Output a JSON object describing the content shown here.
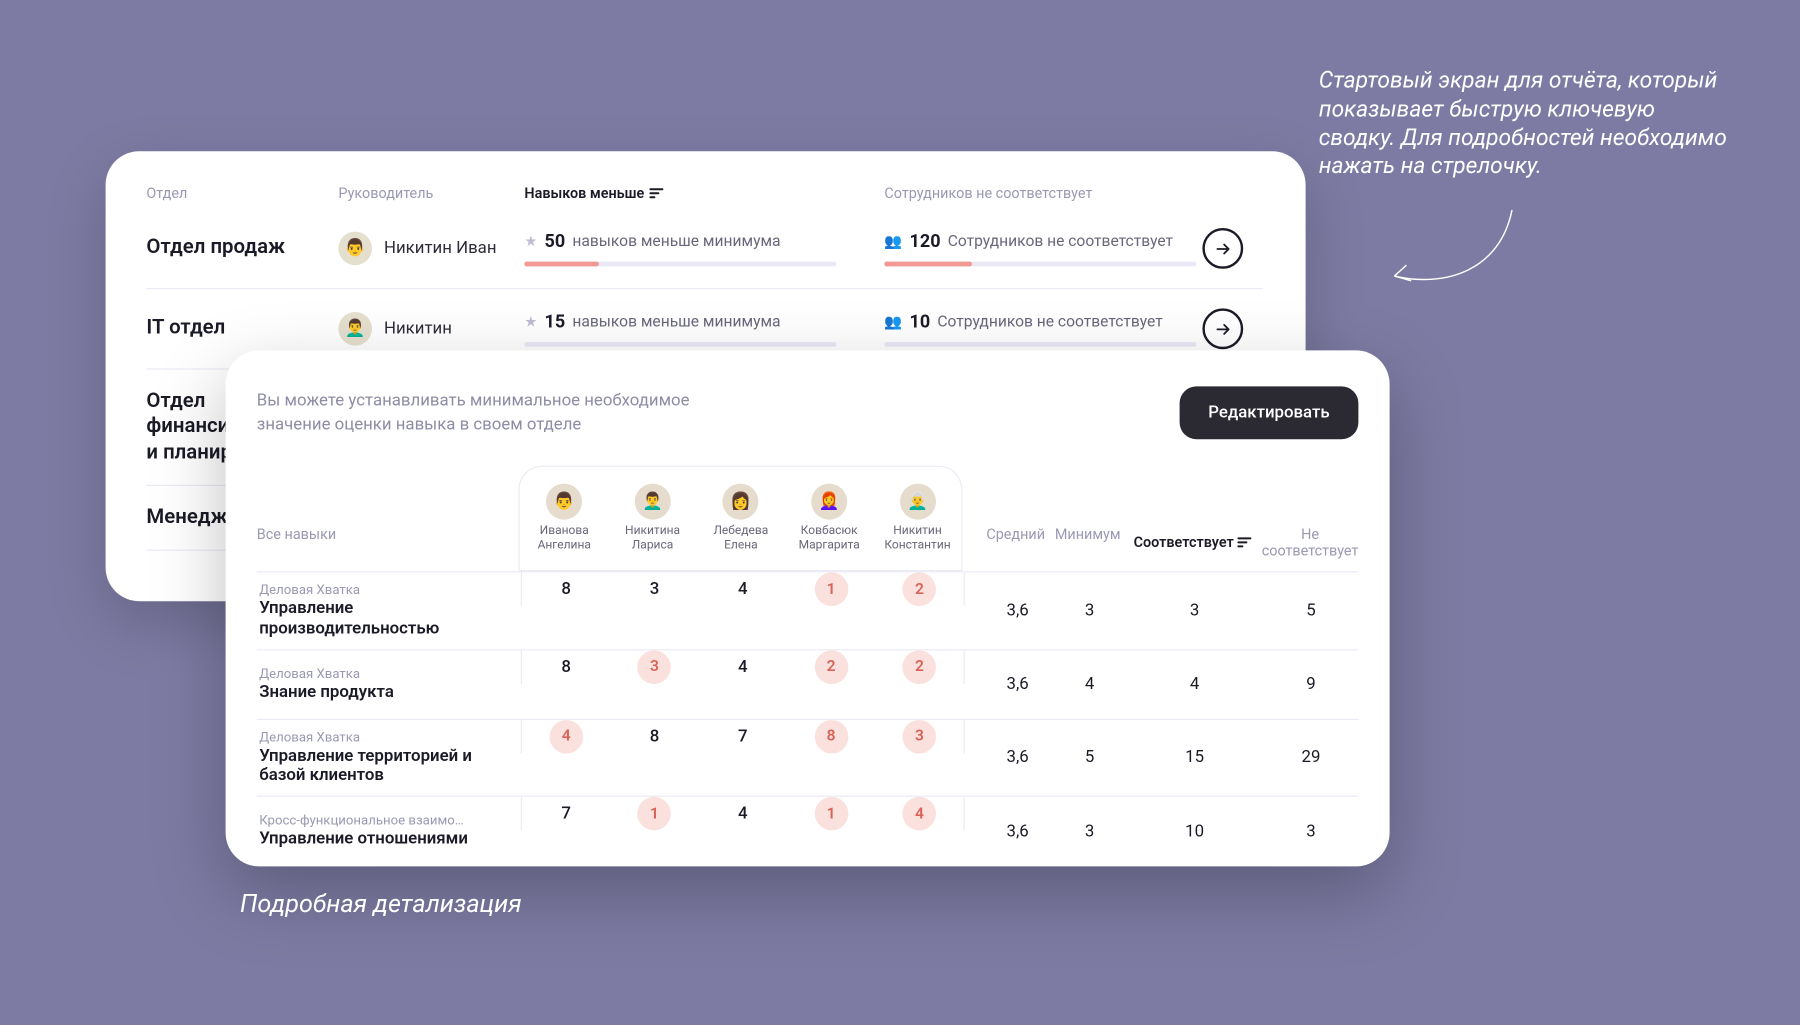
{
  "annotations": {
    "top": "Стартовый экран для отчёта, который показывает быструю ключевую сводку. Для подробностей необходимо нажать на стрелочку.",
    "bottom": "Подробная детализация"
  },
  "back": {
    "headers": {
      "dept": "Отдел",
      "manager": "Руководитель",
      "skills": "Навыков меньше",
      "employees": "Сотрудников не соответствует"
    },
    "rows": [
      {
        "dept": "Отдел продаж",
        "manager": "Никитин Иван",
        "skills_n": "50",
        "skills_txt": "навыков меньше минимума",
        "skills_pct": 24,
        "emp_n": "120",
        "emp_txt": "Сотрудников не соответствует",
        "emp_pct": 28
      },
      {
        "dept": "IT отдел",
        "manager": "Никитин",
        "skills_n": "15",
        "skills_txt": "навыков меньше минимума",
        "skills_pct": 0,
        "emp_n": "10",
        "emp_txt": "Сотрудников не соответствует",
        "emp_pct": 0
      },
      {
        "dept": "Отдел\nфинансир\nи планиро",
        "manager": "",
        "skills_n": "",
        "skills_txt": "",
        "skills_pct": 0,
        "emp_n": "",
        "emp_txt": "",
        "emp_pct": 0
      },
      {
        "dept": "Менеджм",
        "manager": "",
        "skills_n": "",
        "skills_txt": "",
        "skills_pct": 0,
        "emp_n": "",
        "emp_txt": "",
        "emp_pct": 0
      }
    ]
  },
  "front": {
    "intro": "Вы можете устанавливать минимальное необходимое значение оценки навыка в своем отделе",
    "edit": "Редактировать",
    "skill_header": "Все навыки",
    "agg_headers": {
      "avg": "Средний",
      "min": "Минимум",
      "match": "Соответствует",
      "nomatch": "Не соответствует"
    },
    "people": [
      {
        "first": "Иванова",
        "last": "Ангелина"
      },
      {
        "first": "Никитина",
        "last": "Лариса"
      },
      {
        "first": "Лебедева",
        "last": "Елена"
      },
      {
        "first": "Ковбасюк",
        "last": "Маргарита"
      },
      {
        "first": "Никитин",
        "last": "Константин"
      }
    ],
    "rows": [
      {
        "cat": "Деловая Хватка",
        "name": "Управление производительностью",
        "vals": [
          {
            "v": "8",
            "bad": false
          },
          {
            "v": "3",
            "bad": false
          },
          {
            "v": "4",
            "bad": false
          },
          {
            "v": "1",
            "bad": true
          },
          {
            "v": "2",
            "bad": true
          }
        ],
        "avg": "3,6",
        "min": "3",
        "match": "3",
        "nomatch": "5"
      },
      {
        "cat": "Деловая Хватка",
        "name": "Знание продукта",
        "vals": [
          {
            "v": "8",
            "bad": false
          },
          {
            "v": "3",
            "bad": true
          },
          {
            "v": "4",
            "bad": false
          },
          {
            "v": "2",
            "bad": true
          },
          {
            "v": "2",
            "bad": true
          }
        ],
        "avg": "3,6",
        "min": "4",
        "match": "4",
        "nomatch": "9"
      },
      {
        "cat": "Деловая Хватка",
        "name": "Управление территорией и базой клиентов",
        "vals": [
          {
            "v": "4",
            "bad": true
          },
          {
            "v": "8",
            "bad": false
          },
          {
            "v": "7",
            "bad": false
          },
          {
            "v": "8",
            "bad": true
          },
          {
            "v": "3",
            "bad": true
          }
        ],
        "avg": "3,6",
        "min": "5",
        "match": "15",
        "nomatch": "29"
      },
      {
        "cat": "Кросс-функциональное взаимо…",
        "name": "Управление отношениями",
        "vals": [
          {
            "v": "7",
            "bad": false
          },
          {
            "v": "1",
            "bad": true
          },
          {
            "v": "4",
            "bad": false
          },
          {
            "v": "1",
            "bad": true
          },
          {
            "v": "4",
            "bad": true
          }
        ],
        "avg": "3,6",
        "min": "3",
        "match": "10",
        "nomatch": "3"
      }
    ]
  }
}
